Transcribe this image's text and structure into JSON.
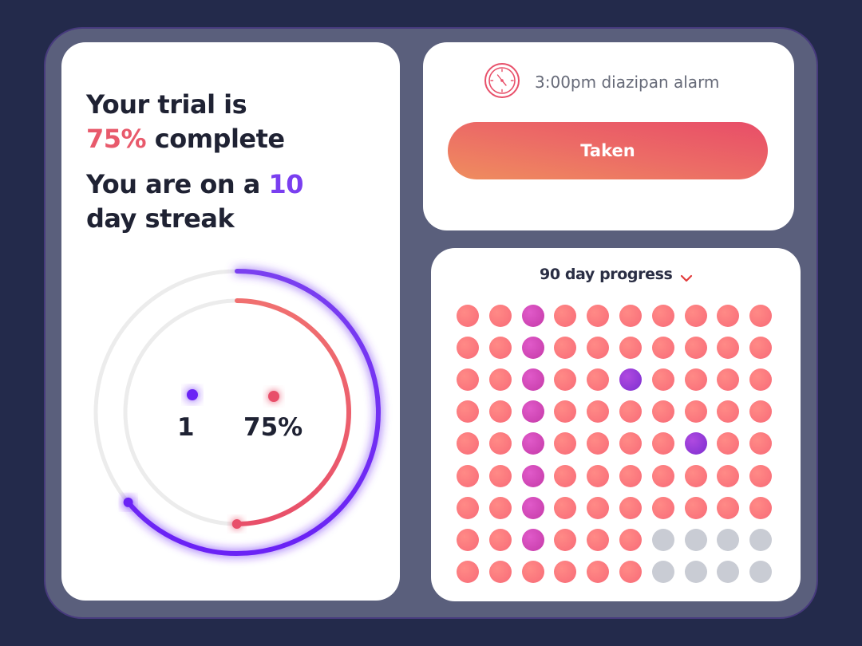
{
  "trial": {
    "line1": "Your trial is",
    "percent": "75%",
    "line2_suffix": " complete",
    "streak_prefix": "You are on a ",
    "streak_days": "10",
    "streak_suffix": "day streak",
    "progress_fraction": 0.75,
    "streak_fraction": 0.64
  },
  "rings": {
    "streak_value": "1",
    "percent_value": "75%"
  },
  "alarm": {
    "icon": "clock-icon",
    "label": "3:00pm diazipan alarm",
    "button_label": "Taken"
  },
  "progress": {
    "title": "90 day progress",
    "dropdown_icon": "chevron-down-icon",
    "columns": 10,
    "rows": 9,
    "completed_days": 86,
    "special_days": [
      {
        "index": 2,
        "kind": "missed"
      },
      {
        "index": 12,
        "kind": "missed"
      },
      {
        "index": 22,
        "kind": "missed"
      },
      {
        "index": 32,
        "kind": "missed"
      },
      {
        "index": 42,
        "kind": "missed"
      },
      {
        "index": 52,
        "kind": "missed"
      },
      {
        "index": 62,
        "kind": "missed"
      },
      {
        "index": 72,
        "kind": "missed"
      },
      {
        "index": 25,
        "kind": "bonus"
      },
      {
        "index": 47,
        "kind": "bonus"
      }
    ]
  },
  "colors": {
    "background": "#232a4b",
    "accent_red": "#e85a6c",
    "accent_purple": "#7a3ff0",
    "ring_track": "#ececec"
  }
}
